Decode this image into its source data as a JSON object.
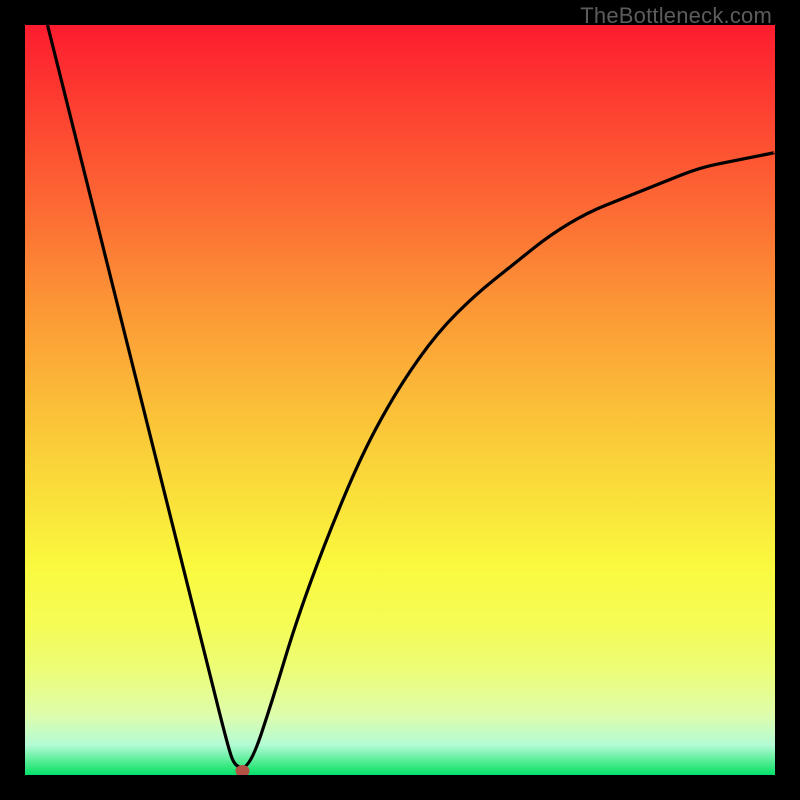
{
  "attribution": "TheBottleneck.com",
  "chart_data": {
    "type": "line",
    "title": "",
    "xlabel": "",
    "ylabel": "",
    "xlim": [
      0,
      100
    ],
    "ylim": [
      0,
      100
    ],
    "grid": false,
    "legend": false,
    "marker": {
      "x": 29,
      "y": 0.5,
      "color": "#b25044"
    },
    "series": [
      {
        "name": "curve",
        "color": "#000000",
        "x": [
          3,
          6,
          9,
          12,
          15,
          18,
          21,
          24,
          27,
          28,
          30,
          33,
          36,
          40,
          45,
          50,
          55,
          60,
          65,
          70,
          75,
          80,
          85,
          90,
          95,
          100
        ],
        "values": [
          100,
          88,
          76,
          64,
          52,
          40,
          28,
          16,
          4,
          1,
          1,
          10,
          20,
          31,
          43,
          52,
          59,
          64,
          68,
          72,
          75,
          77,
          79,
          81,
          82,
          83
        ]
      }
    ],
    "background_gradient": {
      "stops": [
        {
          "pos": 0,
          "color": "#fd1c2f"
        },
        {
          "pos": 25,
          "color": "#fd6c34"
        },
        {
          "pos": 50,
          "color": "#fbbc38"
        },
        {
          "pos": 75,
          "color": "#f6fc4a"
        },
        {
          "pos": 94,
          "color": "#d6fdbc"
        },
        {
          "pos": 100,
          "color": "#02e16b"
        }
      ]
    }
  }
}
